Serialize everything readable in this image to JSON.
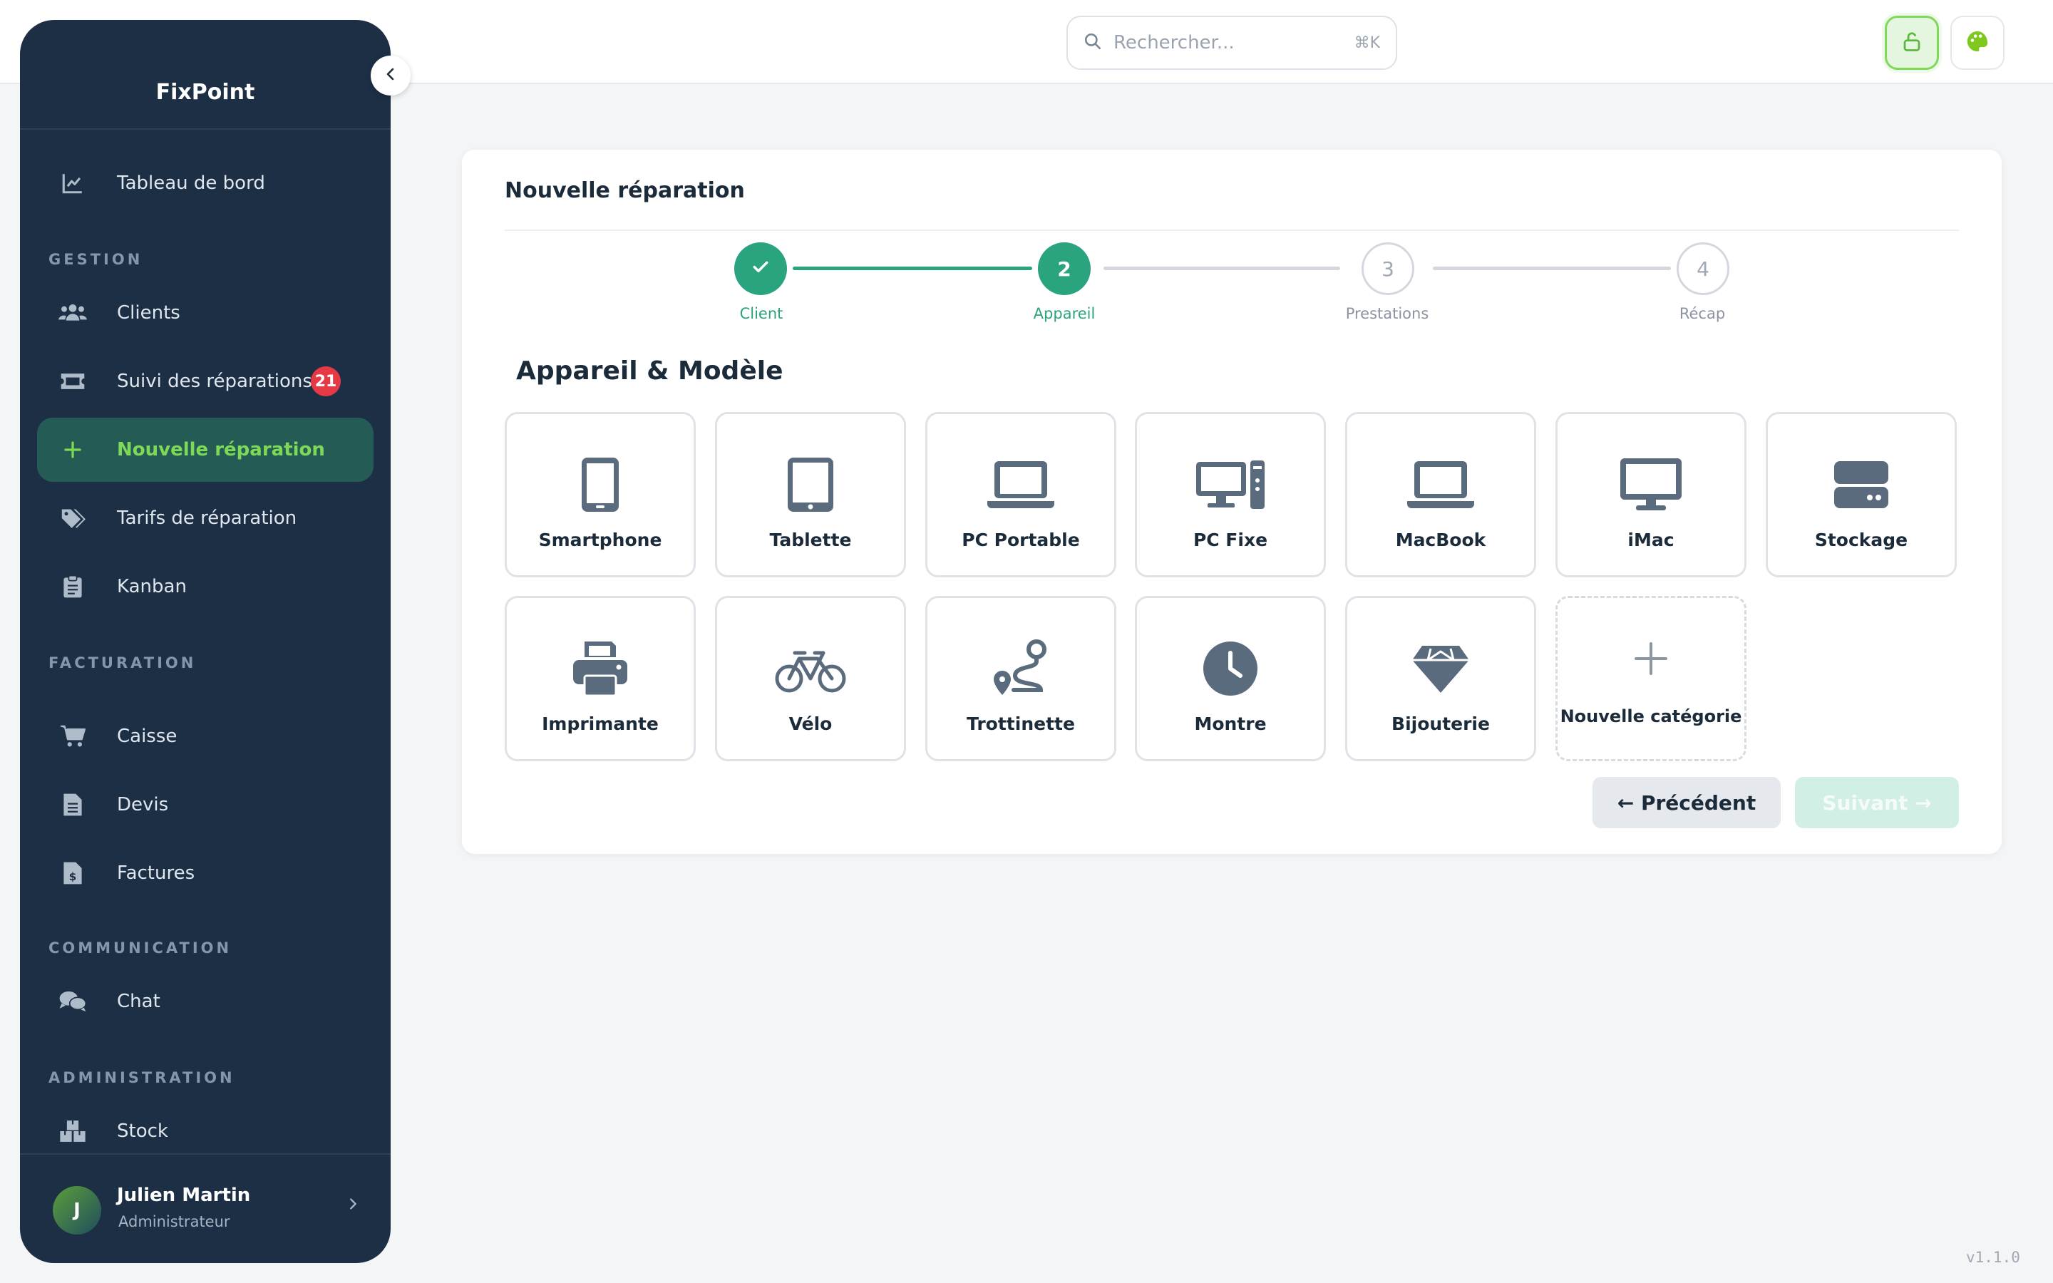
{
  "app": {
    "brand": "FixPoint",
    "version": "v1.1.0"
  },
  "header": {
    "search_placeholder": "Rechercher...",
    "search_shortcut": "⌘K",
    "lock_icon": "unlock-icon",
    "theme_icon": "palette-icon"
  },
  "sidebar": {
    "items": [
      {
        "label": "Tableau de bord",
        "icon": "chart-line-icon"
      },
      {
        "label": "Clients",
        "icon": "users-icon"
      },
      {
        "label": "Suivi des réparations",
        "icon": "ticket-icon",
        "badge": "21"
      },
      {
        "label": "Nouvelle réparation",
        "icon": "plus-icon",
        "active": true
      },
      {
        "label": "Tarifs de réparation",
        "icon": "tags-icon"
      },
      {
        "label": "Kanban",
        "icon": "clipboard-icon"
      },
      {
        "label": "Caisse",
        "icon": "cart-icon"
      },
      {
        "label": "Devis",
        "icon": "file-icon"
      },
      {
        "label": "Factures",
        "icon": "invoice-icon"
      },
      {
        "label": "Chat",
        "icon": "comments-icon"
      },
      {
        "label": "Stock",
        "icon": "boxes-icon"
      }
    ],
    "sections": [
      "GESTION",
      "FACTURATION",
      "COMMUNICATION",
      "ADMINISTRATION"
    ],
    "user": {
      "initial": "J",
      "name": "Julien Martin",
      "role": "Administrateur"
    }
  },
  "card": {
    "title": "Nouvelle réparation",
    "steps": [
      {
        "number": "1",
        "label": "Client",
        "state": "done"
      },
      {
        "number": "2",
        "label": "Appareil",
        "state": "current"
      },
      {
        "number": "3",
        "label": "Prestations",
        "state": "todo"
      },
      {
        "number": "4",
        "label": "Récap",
        "state": "todo"
      }
    ],
    "section_title": "Appareil & Modèle",
    "devices": [
      {
        "label": "Smartphone",
        "icon": "smartphone-icon"
      },
      {
        "label": "Tablette",
        "icon": "tablet-icon"
      },
      {
        "label": "PC Portable",
        "icon": "laptop-icon"
      },
      {
        "label": "PC Fixe",
        "icon": "desktop-icon"
      },
      {
        "label": "MacBook",
        "icon": "laptop-icon"
      },
      {
        "label": "iMac",
        "icon": "monitor-icon"
      },
      {
        "label": "Stockage",
        "icon": "hdd-icon"
      },
      {
        "label": "Imprimante",
        "icon": "printer-icon"
      },
      {
        "label": "Vélo",
        "icon": "bicycle-icon"
      },
      {
        "label": "Trottinette",
        "icon": "route-icon"
      },
      {
        "label": "Montre",
        "icon": "clock-icon"
      },
      {
        "label": "Bijouterie",
        "icon": "gem-icon"
      }
    ],
    "new_category": {
      "label": "Nouvelle catégorie",
      "icon": "plus-icon"
    },
    "prev_label": "← Précédent",
    "next_label": "Suivant →"
  },
  "colors": {
    "accent": "#2aa37f",
    "active_text": "#7ed957",
    "sidebar_bg": "#1c2f45",
    "badge": "#e63946"
  }
}
